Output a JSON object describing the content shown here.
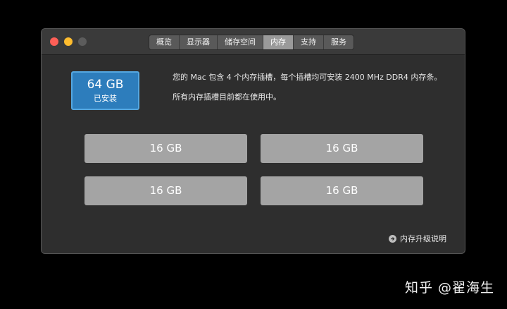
{
  "window": {
    "tabs": [
      {
        "label": "概览"
      },
      {
        "label": "显示器"
      },
      {
        "label": "储存空间"
      },
      {
        "label": "内存",
        "active": true
      },
      {
        "label": "支持"
      },
      {
        "label": "服务"
      }
    ]
  },
  "memory": {
    "installed_amount": "64 GB",
    "installed_label": "已安装",
    "description_line1": "您的 Mac 包含 4 个内存插槽，每个插槽均可安装 2400 MHz DDR4 内存条。",
    "description_line2": "所有内存插槽目前都在使用中。",
    "slots": [
      "16 GB",
      "16 GB",
      "16 GB",
      "16 GB"
    ],
    "upgrade_link": "内存升级说明"
  },
  "watermark": "知乎 @翟海生",
  "colors": {
    "installed_bg": "#2d7dbc",
    "slot_bg": "#a4a4a4",
    "active_tab": "#9a9a9a"
  }
}
